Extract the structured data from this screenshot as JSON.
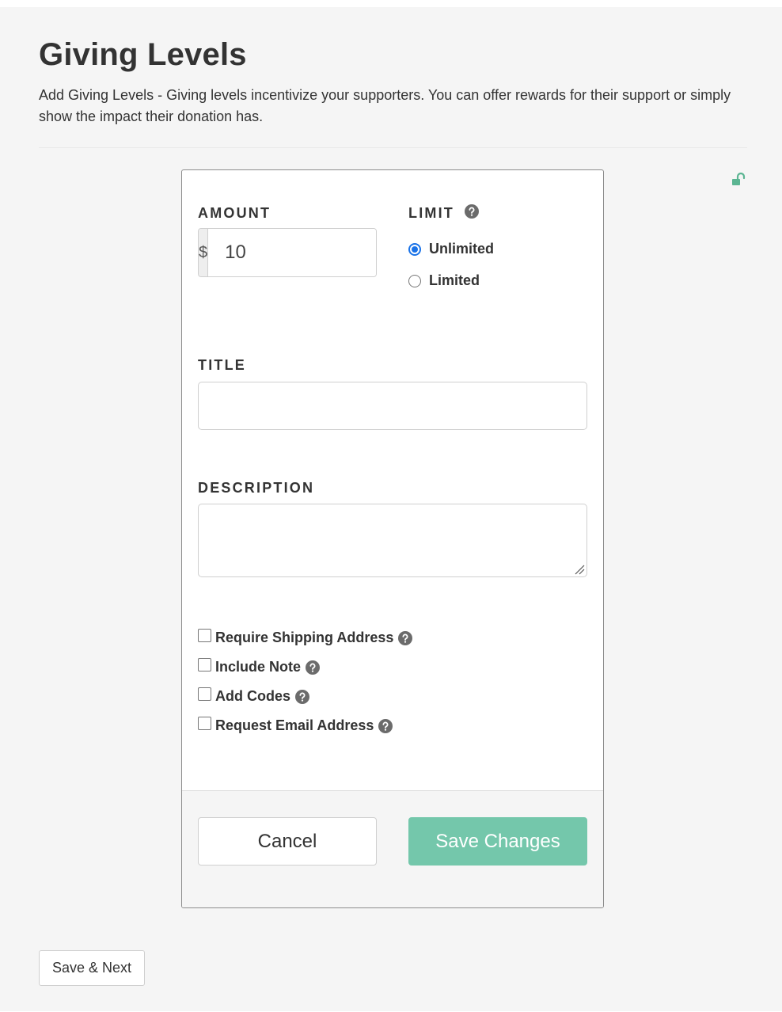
{
  "header": {
    "title": "Giving Levels",
    "description": "Add Giving Levels - Giving levels incentivize your supporters. You can offer rewards for their support or simply show the impact their donation has."
  },
  "icons": {
    "lock": "unlock-icon",
    "help": "question-circle-icon",
    "accent_color": "#5bb592"
  },
  "form": {
    "amount": {
      "label": "AMOUNT",
      "currency_symbol": "$",
      "value": "10"
    },
    "limit": {
      "label": "LIMIT",
      "options": [
        {
          "label": "Unlimited",
          "checked": true
        },
        {
          "label": "Limited",
          "checked": false
        }
      ]
    },
    "title": {
      "label": "TITLE",
      "value": ""
    },
    "description": {
      "label": "DESCRIPTION",
      "value": ""
    },
    "options": [
      {
        "label": "Require Shipping Address",
        "checked": false
      },
      {
        "label": "Include Note",
        "checked": false
      },
      {
        "label": "Add Codes",
        "checked": false
      },
      {
        "label": "Request Email Address",
        "checked": false
      }
    ]
  },
  "footer": {
    "cancel_label": "Cancel",
    "save_label": "Save Changes",
    "save_color": "#74c7ab"
  },
  "page_actions": {
    "save_next_label": "Save & Next"
  }
}
